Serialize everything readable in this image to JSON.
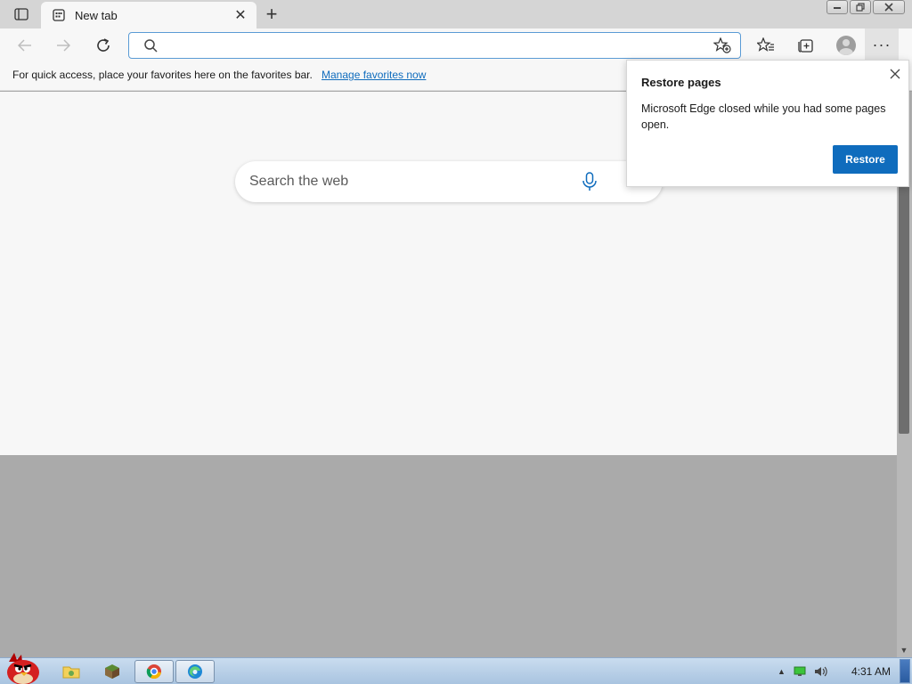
{
  "tabstrip": {
    "tab_title": "New tab",
    "tab_close_glyph": "✕",
    "new_tab_glyph": "+"
  },
  "toolbar": {
    "address_value": "",
    "more_glyph": "···"
  },
  "favorites_bar": {
    "text": "For quick access, place your favorites here on the favorites bar.",
    "link": "Manage favorites now"
  },
  "page": {
    "search_placeholder": "Search the web"
  },
  "restore_popup": {
    "title": "Restore pages",
    "message": "Microsoft Edge closed while you had some pages open.",
    "button": "Restore"
  },
  "taskbar": {
    "clock": "4:31 AM",
    "tray_arrow": "▲"
  },
  "scrollbar": {
    "down_glyph": "▼"
  },
  "colors": {
    "accent": "#0f6cbd",
    "tabstrip_bg": "#d5d5d5",
    "page_bg": "#f7f7f7",
    "desktop_gray": "#aaaaaa"
  },
  "icons": [
    "tab-actions-icon",
    "new-tab-page-icon",
    "back-arrow-icon",
    "forward-arrow-icon",
    "refresh-icon",
    "search-icon",
    "add-favorite-icon",
    "favorites-icon",
    "collections-icon",
    "profile-icon",
    "more-icon",
    "microphone-icon",
    "close-icon"
  ]
}
